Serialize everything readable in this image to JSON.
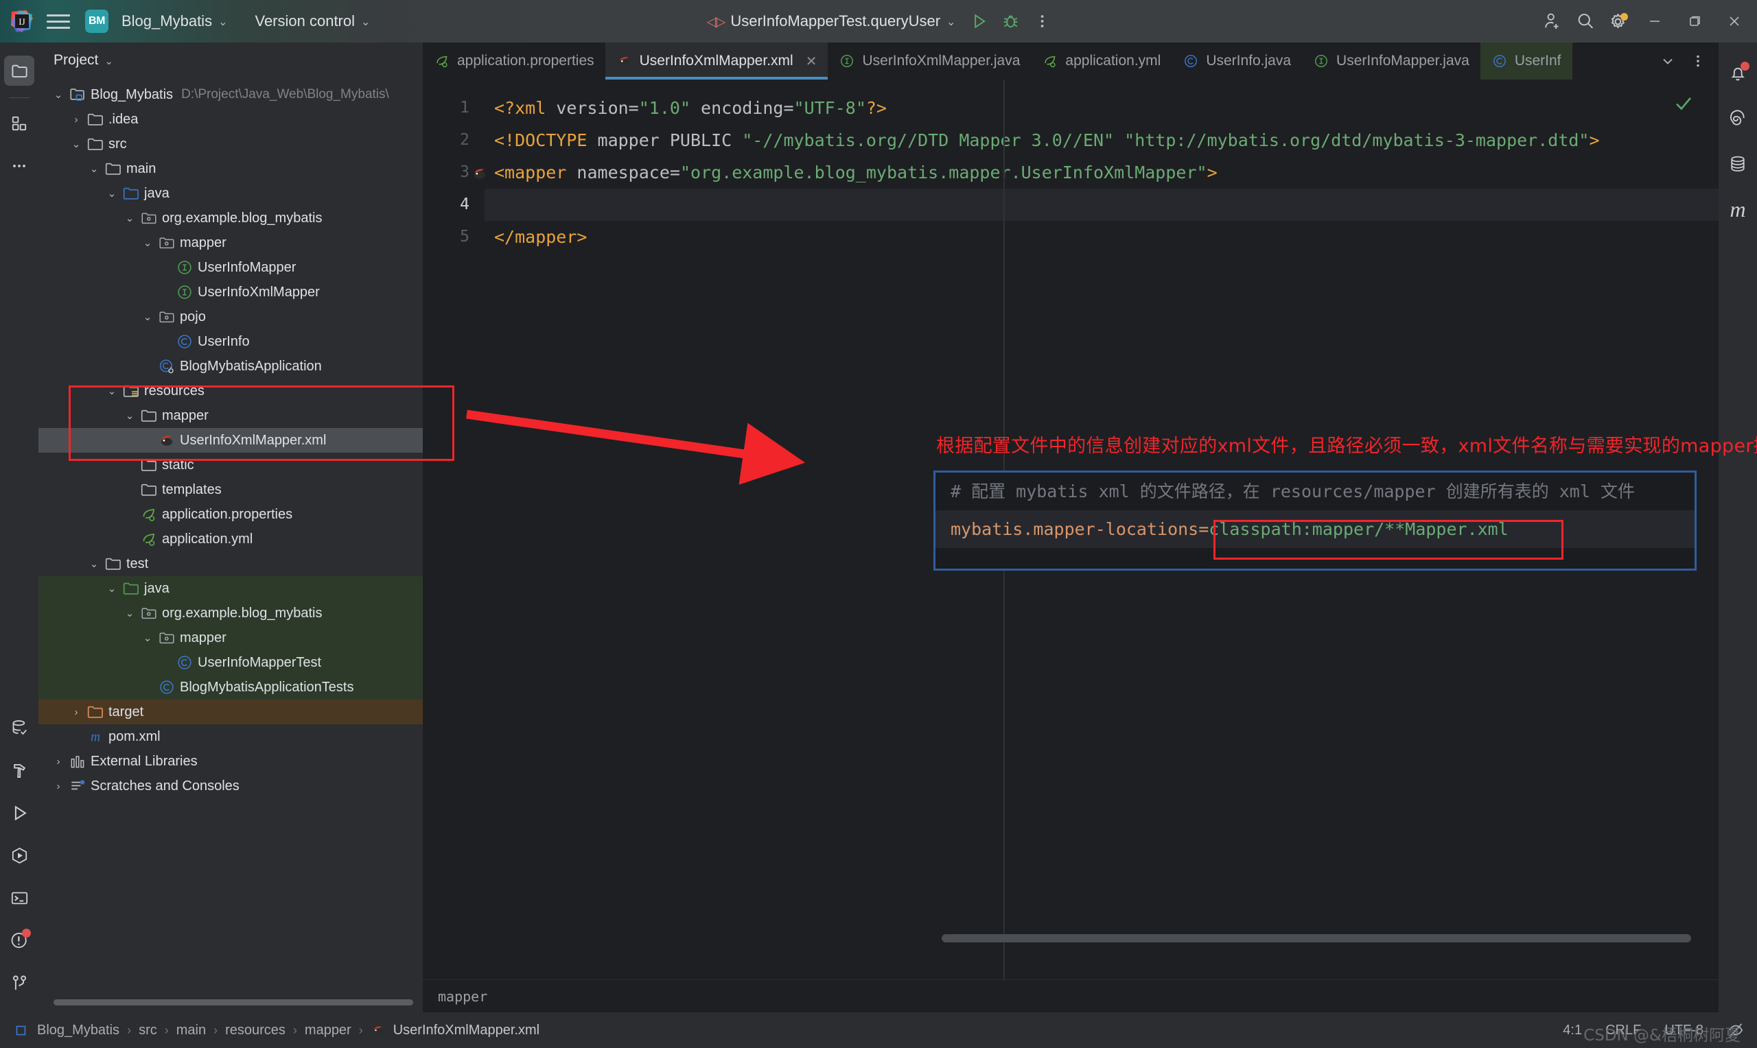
{
  "titlebar": {
    "menu_icon": "hamburger-icon",
    "project_badge": "BM",
    "project_name": "Blog_Mybatis",
    "version_control": "Version control",
    "run_config": "UserInfoMapperTest.queryUser",
    "run_icon": "run-icon",
    "debug_icon": "debug-icon",
    "more_icon": "more-vertical-icon",
    "account_icon": "add-account-icon",
    "search_icon": "search-icon",
    "settings_icon": "gear-icon",
    "minimize": "minimize-icon",
    "maximize": "maximize-icon",
    "close": "close-icon"
  },
  "left_rail": {
    "items": [
      {
        "name": "project-tool-window",
        "icon": "folder-icon",
        "active": true
      },
      {
        "name": "structure-tool-window",
        "icon": "modules-icon",
        "active": false
      },
      {
        "name": "more-tool-windows",
        "icon": "ellipsis-icon",
        "active": false
      }
    ],
    "bottom_items": [
      {
        "name": "database-tool-window",
        "icon": "database-check-icon"
      },
      {
        "name": "build-tool-window",
        "icon": "hammer-icon"
      },
      {
        "name": "run-tool-window",
        "icon": "play-icon"
      },
      {
        "name": "services-tool-window",
        "icon": "services-icon"
      },
      {
        "name": "terminal-tool-window",
        "icon": "terminal-icon"
      },
      {
        "name": "problems-tool-window",
        "icon": "warning-circle-icon"
      },
      {
        "name": "git-tool-window",
        "icon": "branch-icon"
      }
    ]
  },
  "right_rail": {
    "items": [
      {
        "name": "notifications",
        "icon": "bell-icon",
        "badge": true
      },
      {
        "name": "ai-assistant",
        "icon": "spiral-icon"
      },
      {
        "name": "database",
        "icon": "database-icon"
      },
      {
        "name": "maven",
        "icon": "maven-m-icon"
      }
    ]
  },
  "project_panel": {
    "title": "Project",
    "tree": [
      {
        "depth": 0,
        "arrow": "expanded",
        "icon": "module-icon",
        "label": "Blog_Mybatis",
        "hint": "D:\\Project\\Java_Web\\Blog_Mybatis\\",
        "state": "normal"
      },
      {
        "depth": 1,
        "arrow": "collapsed",
        "icon": "folder-icon",
        "label": ".idea",
        "hint": "",
        "state": "normal"
      },
      {
        "depth": 1,
        "arrow": "expanded",
        "icon": "folder-icon",
        "label": "src",
        "hint": "",
        "state": "normal"
      },
      {
        "depth": 2,
        "arrow": "expanded",
        "icon": "folder-icon",
        "label": "main",
        "hint": "",
        "state": "normal"
      },
      {
        "depth": 3,
        "arrow": "expanded",
        "icon": "folder-source-icon",
        "label": "java",
        "hint": "",
        "state": "normal"
      },
      {
        "depth": 4,
        "arrow": "expanded",
        "icon": "package-icon",
        "label": "org.example.blog_mybatis",
        "hint": "",
        "state": "normal"
      },
      {
        "depth": 5,
        "arrow": "expanded",
        "icon": "package-icon",
        "label": "mapper",
        "hint": "",
        "state": "normal"
      },
      {
        "depth": 6,
        "arrow": "none",
        "icon": "interface-icon",
        "label": "UserInfoMapper",
        "hint": "",
        "state": "normal"
      },
      {
        "depth": 6,
        "arrow": "none",
        "icon": "interface-icon",
        "label": "UserInfoXmlMapper",
        "hint": "",
        "state": "normal"
      },
      {
        "depth": 5,
        "arrow": "expanded",
        "icon": "package-icon",
        "label": "pojo",
        "hint": "",
        "state": "normal"
      },
      {
        "depth": 6,
        "arrow": "none",
        "icon": "class-icon",
        "label": "UserInfo",
        "hint": "",
        "state": "normal"
      },
      {
        "depth": 5,
        "arrow": "none",
        "icon": "spring-class-icon",
        "label": "BlogMybatisApplication",
        "hint": "",
        "state": "normal"
      },
      {
        "depth": 3,
        "arrow": "expanded",
        "icon": "folder-resource-icon",
        "label": "resources",
        "hint": "",
        "state": "normal"
      },
      {
        "depth": 4,
        "arrow": "expanded",
        "icon": "folder-icon",
        "label": "mapper",
        "hint": "",
        "state": "normal"
      },
      {
        "depth": 5,
        "arrow": "none",
        "icon": "mybatis-icon",
        "label": "UserInfoXmlMapper.xml",
        "hint": "",
        "state": "selected"
      },
      {
        "depth": 4,
        "arrow": "none",
        "icon": "folder-icon",
        "label": "static",
        "hint": "",
        "state": "normal"
      },
      {
        "depth": 4,
        "arrow": "none",
        "icon": "folder-icon",
        "label": "templates",
        "hint": "",
        "state": "normal"
      },
      {
        "depth": 4,
        "arrow": "none",
        "icon": "spring-file-icon",
        "label": "application.properties",
        "hint": "",
        "state": "normal"
      },
      {
        "depth": 4,
        "arrow": "none",
        "icon": "spring-file-icon",
        "label": "application.yml",
        "hint": "",
        "state": "normal"
      },
      {
        "depth": 2,
        "arrow": "expanded",
        "icon": "folder-icon",
        "label": "test",
        "hint": "",
        "state": "normal"
      },
      {
        "depth": 3,
        "arrow": "expanded",
        "icon": "folder-test-icon",
        "label": "java",
        "hint": "",
        "state": "test"
      },
      {
        "depth": 4,
        "arrow": "expanded",
        "icon": "package-icon",
        "label": "org.example.blog_mybatis",
        "hint": "",
        "state": "test"
      },
      {
        "depth": 5,
        "arrow": "expanded",
        "icon": "package-icon",
        "label": "mapper",
        "hint": "",
        "state": "test"
      },
      {
        "depth": 6,
        "arrow": "none",
        "icon": "class-icon",
        "label": "UserInfoMapperTest",
        "hint": "",
        "state": "test"
      },
      {
        "depth": 5,
        "arrow": "none",
        "icon": "class-icon",
        "label": "BlogMybatisApplicationTests",
        "hint": "",
        "state": "test"
      },
      {
        "depth": 1,
        "arrow": "collapsed",
        "icon": "folder-target-icon",
        "label": "target",
        "hint": "",
        "state": "target"
      },
      {
        "depth": 1,
        "arrow": "none",
        "icon": "maven-m-icon",
        "label": "pom.xml",
        "hint": "",
        "state": "normal"
      },
      {
        "depth": 0,
        "arrow": "collapsed",
        "icon": "libraries-icon",
        "label": "External Libraries",
        "hint": "",
        "state": "normal"
      },
      {
        "depth": 0,
        "arrow": "collapsed",
        "icon": "scratches-icon",
        "label": "Scratches and Consoles",
        "hint": "",
        "state": "normal"
      }
    ]
  },
  "editor": {
    "tabs": [
      {
        "label": "application.properties",
        "icon": "spring-file-icon",
        "active": false,
        "closable": false
      },
      {
        "label": "UserInfoXmlMapper.xml",
        "icon": "mybatis-icon",
        "active": true,
        "closable": true
      },
      {
        "label": "UserInfoXmlMapper.java",
        "icon": "interface-icon",
        "active": false,
        "closable": false
      },
      {
        "label": "application.yml",
        "icon": "spring-file-icon",
        "active": false,
        "closable": false
      },
      {
        "label": "UserInfo.java",
        "icon": "class-icon",
        "active": false,
        "closable": false
      },
      {
        "label": "UserInfoMapper.java",
        "icon": "interface-icon",
        "active": false,
        "closable": false
      },
      {
        "label": "UserInf",
        "icon": "class-icon",
        "active": false,
        "closable": false,
        "truncated": true
      }
    ],
    "tab_list_icon": "chevron-down-icon",
    "tab_options_icon": "more-vertical-icon",
    "lines": [
      {
        "no": "1",
        "cur": false,
        "parts": [
          {
            "t": "tag",
            "s": "<?xml"
          },
          {
            "t": "attr",
            "s": " version="
          },
          {
            "t": "str",
            "s": "\"1.0\""
          },
          {
            "t": "attr",
            "s": " encoding="
          },
          {
            "t": "str",
            "s": "\"UTF-8\""
          },
          {
            "t": "tag",
            "s": "?>"
          }
        ]
      },
      {
        "no": "2",
        "cur": false,
        "parts": [
          {
            "t": "tag",
            "s": "<!DOCTYPE"
          },
          {
            "t": "attr",
            "s": " mapper PUBLIC "
          },
          {
            "t": "str",
            "s": "\"-//mybatis.org//DTD Mapper 3.0//EN\""
          },
          {
            "t": "attr",
            "s": " "
          },
          {
            "t": "str",
            "s": "\"http://mybatis.org/dtd/mybatis-3-mapper.dtd\""
          },
          {
            "t": "tag",
            "s": ">"
          }
        ]
      },
      {
        "no": "3",
        "cur": false,
        "gutter_icon": "mybatis-icon",
        "parts": [
          {
            "t": "tag",
            "s": "<mapper"
          },
          {
            "t": "attr",
            "s": " namespace="
          },
          {
            "t": "str",
            "s": "\"org.example.blog_mybatis.mapper.UserInfoXmlMapper\""
          },
          {
            "t": "tag",
            "s": ">"
          }
        ]
      },
      {
        "no": "4",
        "cur": true,
        "parts": []
      },
      {
        "no": "5",
        "cur": false,
        "parts": [
          {
            "t": "tag",
            "s": "</mapper>"
          }
        ]
      }
    ],
    "inspection_status_icon": "checkmark-icon",
    "breadcrumb": "mapper"
  },
  "annotations": {
    "note_text": "根据配置文件中的信息创建对应的xml文件，且路径必须一致，xml文件名称与需要实现的mapper接口名称保持一致",
    "note_color": "#f2252a",
    "blue_box_color": "#2f5d9e",
    "red_box_color": "#f2252a",
    "config_comment": "# 配置 mybatis xml 的文件路径，在 resources/mapper 创建所有表的 xml 文件",
    "config_key": "mybatis.mapper-locations=",
    "config_value": "classpath:mapper/**Mapper.xml"
  },
  "status_bar": {
    "breadcrumb": [
      "Blog_Mybatis",
      "src",
      "main",
      "resources",
      "mapper",
      "UserInfoXmlMapper.xml"
    ],
    "breadcrumb_leaf_icon": "mybatis-icon",
    "caret": "4:1",
    "line_separator": "CRLF",
    "encoding": "UTF-8",
    "inspection_icon": "inspections-off-icon",
    "watermark": "CSDN @&梧桐树阿夏"
  }
}
